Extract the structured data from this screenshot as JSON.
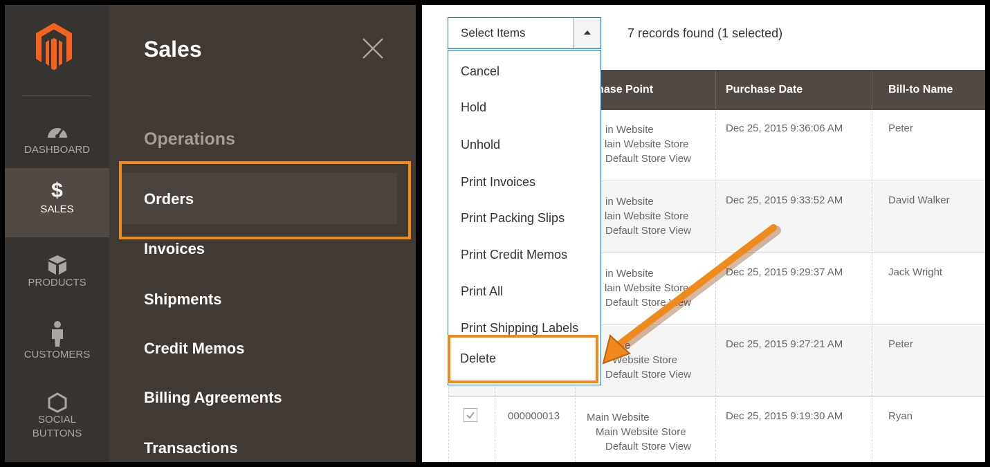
{
  "sidebar": {
    "items": [
      {
        "label": "DASHBOARD",
        "icon": "dashboard-icon"
      },
      {
        "label": "SALES",
        "icon": "dollar-icon"
      },
      {
        "label": "PRODUCTS",
        "icon": "box-icon"
      },
      {
        "label": "CUSTOMERS",
        "icon": "person-icon"
      },
      {
        "label": "SOCIAL BUTTONS",
        "icon": "hexagon-icon"
      }
    ]
  },
  "submenu": {
    "title": "Sales",
    "section": "Operations",
    "links": [
      "Orders",
      "Invoices",
      "Shipments",
      "Credit Memos",
      "Billing Agreements",
      "Transactions"
    ]
  },
  "toolbar": {
    "select_label": "Select Items",
    "records_text": "7 records found (1 selected)"
  },
  "actions": [
    "Cancel",
    "Hold",
    "Unhold",
    "Print Invoices",
    "Print Packing Slips",
    "Print Credit Memos",
    "Print All",
    "Print Shipping Labels",
    "Delete"
  ],
  "grid": {
    "headers": {
      "purchase_point": "rchase Point",
      "purchase_date": "Purchase Date",
      "bill_to": "Bill-to Name"
    },
    "rows": [
      {
        "p1": "in Website",
        "p2": "lain Website Store",
        "p3": "Default Store View",
        "date": "Dec 25, 2015 9:36:06 AM",
        "bill": "Peter"
      },
      {
        "p1": "in Website",
        "p2": "lain Website Store",
        "p3": "Default Store View",
        "date": "Dec 25, 2015 9:33:52 AM",
        "bill": "David Walker"
      },
      {
        "p1": "in Website",
        "p2": "lain Website Store",
        "p3": "Default Store View",
        "date": "Dec 25, 2015 9:29:37 AM",
        "bill": "Jack Wright"
      },
      {
        "p1": "site",
        "p2": "Website Store",
        "p3": "Default Store View",
        "date": "Dec 25, 2015 9:27:21 AM",
        "bill": "Peter"
      },
      {
        "id": "000000013",
        "p1": "Main Website",
        "p2": "Main Website Store",
        "p3": "Default Store View",
        "date": "Dec 25, 2015 9:19:30 AM",
        "bill": "Ryan"
      }
    ]
  },
  "colors": {
    "accent": "#f08a1c",
    "sidebar": "#373330",
    "active": "#514943",
    "link": "#007bdb"
  }
}
